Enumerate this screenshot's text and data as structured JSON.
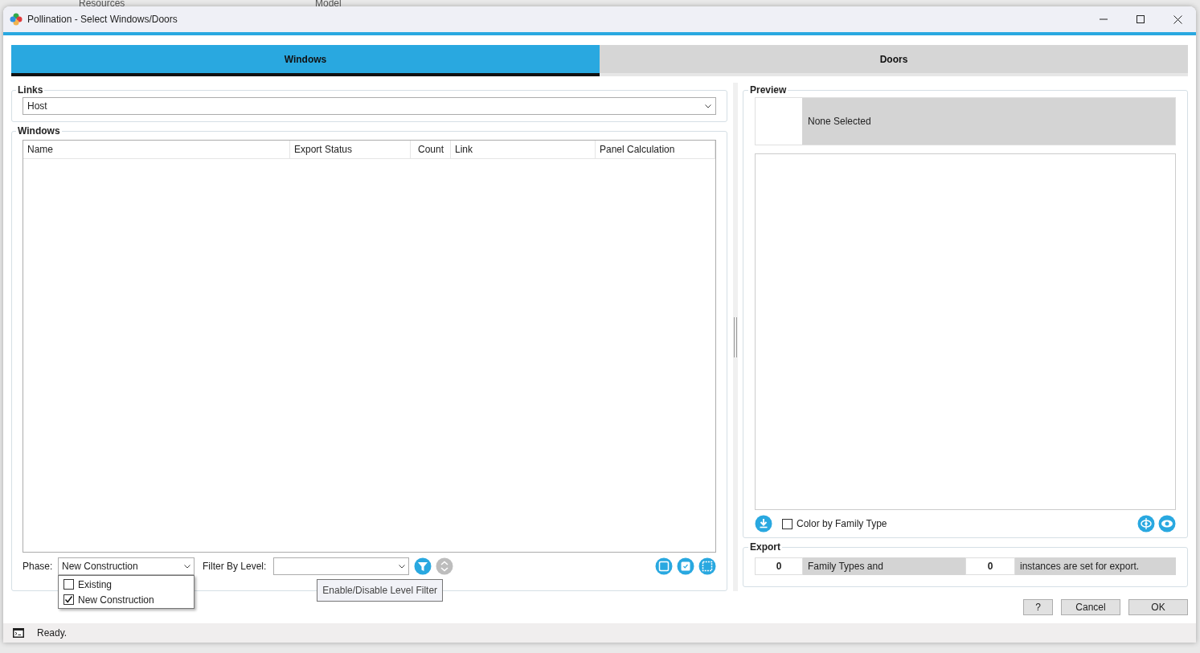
{
  "background_app": {
    "tabs": [
      "Resources",
      "Model"
    ]
  },
  "window": {
    "title": "Pollination - Select Windows/Doors"
  },
  "tabs": [
    {
      "label": "Windows",
      "selected": true
    },
    {
      "label": "Doors",
      "selected": false
    }
  ],
  "links": {
    "label": "Links",
    "value": "Host"
  },
  "windows": {
    "label": "Windows",
    "table": {
      "columns": [
        "Name",
        "Export Status",
        "Count",
        "Link",
        "Panel Calculation"
      ]
    },
    "phase": {
      "label": "Phase:",
      "value": "New Construction",
      "options": [
        {
          "label": "Existing",
          "checked": false
        },
        {
          "label": "New Construction",
          "checked": true
        }
      ]
    },
    "level_filter": {
      "label": "Filter By Level:",
      "tooltip": "Enable/Disable Level Filter"
    }
  },
  "preview": {
    "label": "Preview",
    "selection": "None Selected",
    "color_by_family_type": {
      "label": "Color by Family Type",
      "checked": false
    }
  },
  "export": {
    "label": "Export",
    "family_types_count": "0",
    "family_types_text": "Family Types and",
    "instances_count": "0",
    "instances_text": "instances are set for export."
  },
  "buttons": [
    "?",
    "Cancel",
    "OK"
  ],
  "status_bar": {
    "text": "Ready."
  }
}
